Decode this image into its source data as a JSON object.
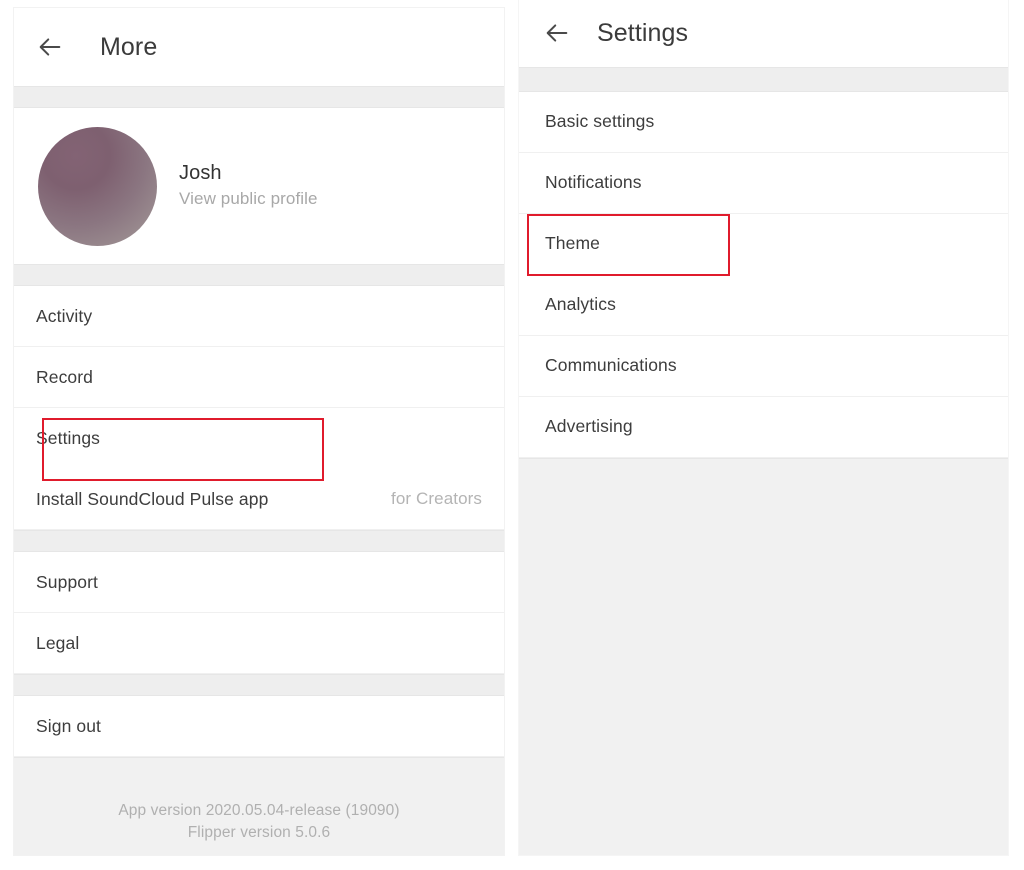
{
  "left_panel": {
    "appbar": {
      "back_icon": "arrow-left-icon",
      "title": "More"
    },
    "profile": {
      "name": "Josh",
      "subtitle": "View public profile",
      "avatar_gradient_from": "#7e6070",
      "avatar_gradient_to": "#a09595"
    },
    "group_one": [
      {
        "label": "Activity",
        "trailing": ""
      },
      {
        "label": "Record",
        "trailing": ""
      },
      {
        "label": "Settings",
        "trailing": "",
        "highlighted": true
      },
      {
        "label": "Install SoundCloud Pulse app",
        "trailing": "for Creators"
      }
    ],
    "group_two": [
      {
        "label": "Support",
        "trailing": ""
      },
      {
        "label": "Legal",
        "trailing": ""
      }
    ],
    "group_three": [
      {
        "label": "Sign out",
        "trailing": ""
      }
    ],
    "footer": {
      "app_version": "App version 2020.05.04-release (19090)",
      "flipper_version": "Flipper version 5.0.6"
    }
  },
  "right_panel": {
    "appbar": {
      "back_icon": "arrow-left-icon",
      "title": "Settings"
    },
    "items": [
      {
        "label": "Basic settings"
      },
      {
        "label": "Notifications"
      },
      {
        "label": "Theme",
        "highlighted": true
      },
      {
        "label": "Analytics"
      },
      {
        "label": "Communications"
      },
      {
        "label": "Advertising"
      }
    ]
  },
  "annotations": {
    "highlight_color": "#e01b2c",
    "settings_box_label": "Settings",
    "theme_box_label": "Theme"
  }
}
